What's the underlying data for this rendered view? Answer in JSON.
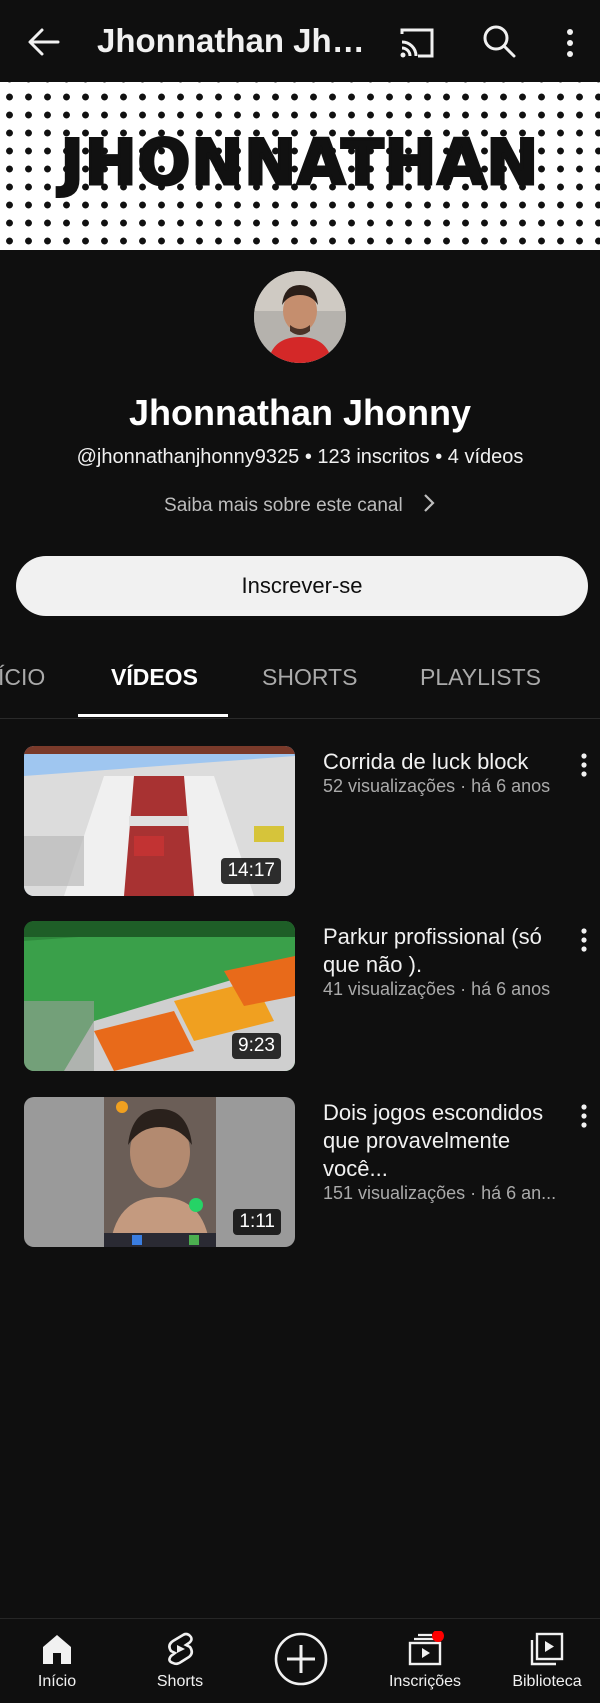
{
  "header": {
    "title": "Jhonnathan Jho...",
    "icons": [
      "back-arrow-icon",
      "cast-icon",
      "search-icon",
      "more-vert-icon"
    ]
  },
  "banner": {
    "text": "JHONNATHAN"
  },
  "channel": {
    "name": "Jhonnathan Jhonny",
    "meta": "@jhonnathanjhonny9325 • 123 inscritos • 4 vídeos",
    "about": "Saiba mais sobre este canal",
    "subscribe_label": "Inscrever-se"
  },
  "tabs": [
    {
      "label": "ÍCIO",
      "active": false
    },
    {
      "label": "VÍDEOS",
      "active": true
    },
    {
      "label": "SHORTS",
      "active": false
    },
    {
      "label": "PLAYLISTS",
      "active": false
    }
  ],
  "videos": [
    {
      "title": "Corrida de luck block",
      "meta": "52 visualizações · há 6 anos",
      "duration": "14:17"
    },
    {
      "title": "Parkur profissional (só que não ).",
      "meta": "41 visualizações · há 6 anos",
      "duration": "9:23"
    },
    {
      "title": "Dois jogos escondidos que provavelmente você...",
      "meta": "151 visualizações · há 6 an...",
      "duration": "1:11"
    }
  ],
  "bottom_nav": [
    {
      "label": "Início",
      "icon": "home-icon"
    },
    {
      "label": "Shorts",
      "icon": "shorts-icon"
    },
    {
      "label": "",
      "icon": "create-icon"
    },
    {
      "label": "Inscrições",
      "icon": "subscriptions-icon",
      "badge": true
    },
    {
      "label": "Biblioteca",
      "icon": "library-icon"
    }
  ],
  "colors": {
    "background": "#0f0f0f",
    "text": "#f1f1f1",
    "secondary_text": "#aaaaaa",
    "badge": "#ff0000"
  }
}
